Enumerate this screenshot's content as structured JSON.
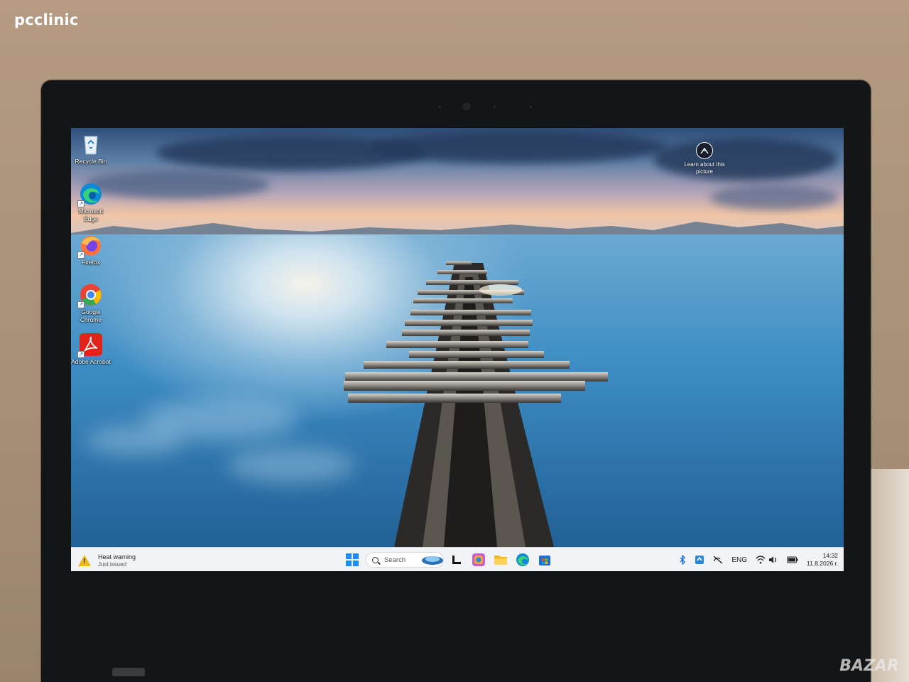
{
  "watermarks": {
    "top": "pcclinic",
    "bottom": "BAZAR"
  },
  "desktop": {
    "icons": [
      {
        "name": "recycle-bin",
        "label": "Recycle Bin"
      },
      {
        "name": "microsoft-edge",
        "label": "Microsoft Edge"
      },
      {
        "name": "firefox",
        "label": "Firefox"
      },
      {
        "name": "google-chrome",
        "label": "Google Chrome"
      },
      {
        "name": "adobe-acrobat",
        "label": "Adobe Acrobat"
      }
    ],
    "learn_about": "Learn about this picture"
  },
  "taskbar": {
    "widget": {
      "title": "Heat warning",
      "subtitle": "Just issued"
    },
    "search_placeholder": "Search",
    "pinned": [
      "start-icon",
      "search",
      "copilot-icon",
      "task-view-icon",
      "microsoft-365-icon",
      "file-explorer-icon",
      "edge-icon",
      "microsoft-store-icon"
    ],
    "tray": {
      "language": "ENG",
      "time": "14:32",
      "date": "11.8.2026 г."
    }
  },
  "colors": {
    "accent": "#1a8cff",
    "taskbar": "#f1f3f6",
    "warning": "#f2b821"
  }
}
